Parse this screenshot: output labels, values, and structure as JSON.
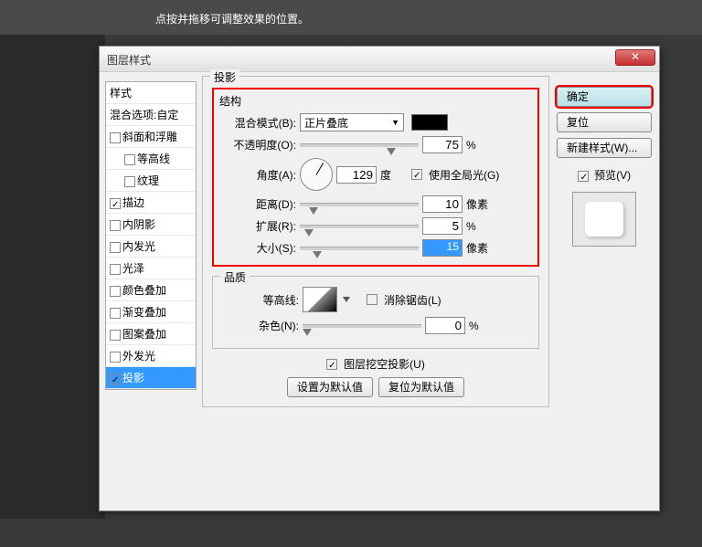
{
  "top_hint": "点按并拖移可调整效果的位置。",
  "dialog_title": "图层样式",
  "close": "✕",
  "styles_header": "样式",
  "blend_options": "混合选项:自定",
  "styles": [
    {
      "label": "斜面和浮雕",
      "checked": false
    },
    {
      "label": "等高线",
      "checked": false,
      "indent": true
    },
    {
      "label": "纹理",
      "checked": false,
      "indent": true
    },
    {
      "label": "描边",
      "checked": true
    },
    {
      "label": "内阴影",
      "checked": false
    },
    {
      "label": "内发光",
      "checked": false
    },
    {
      "label": "光泽",
      "checked": false
    },
    {
      "label": "颜色叠加",
      "checked": false
    },
    {
      "label": "渐变叠加",
      "checked": false
    },
    {
      "label": "图案叠加",
      "checked": false
    },
    {
      "label": "外发光",
      "checked": false
    },
    {
      "label": "投影",
      "checked": true,
      "selected": true
    }
  ],
  "shadow": {
    "section_title": "投影",
    "structure_title": "结构",
    "blend_mode_label": "混合模式(B):",
    "blend_mode_value": "正片叠底",
    "opacity_label": "不透明度(O):",
    "opacity_value": "75",
    "opacity_unit": "%",
    "angle_label": "角度(A):",
    "angle_value": "129",
    "angle_unit": "度",
    "global_light_label": "使用全局光(G)",
    "distance_label": "距离(D):",
    "distance_value": "10",
    "distance_unit": "像素",
    "spread_label": "扩展(R):",
    "spread_value": "5",
    "spread_unit": "%",
    "size_label": "大小(S):",
    "size_value": "15",
    "size_unit": "像素",
    "quality_title": "品质",
    "contour_label": "等高线:",
    "antialias_label": "消除锯齿(L)",
    "noise_label": "杂色(N):",
    "noise_value": "0",
    "noise_unit": "%",
    "knockout_label": "图层挖空投影(U)",
    "set_default": "设置为默认值",
    "reset_default": "复位为默认值"
  },
  "buttons": {
    "ok": "确定",
    "cancel": "复位",
    "new_style": "新建样式(W)...",
    "preview": "预览(V)"
  }
}
